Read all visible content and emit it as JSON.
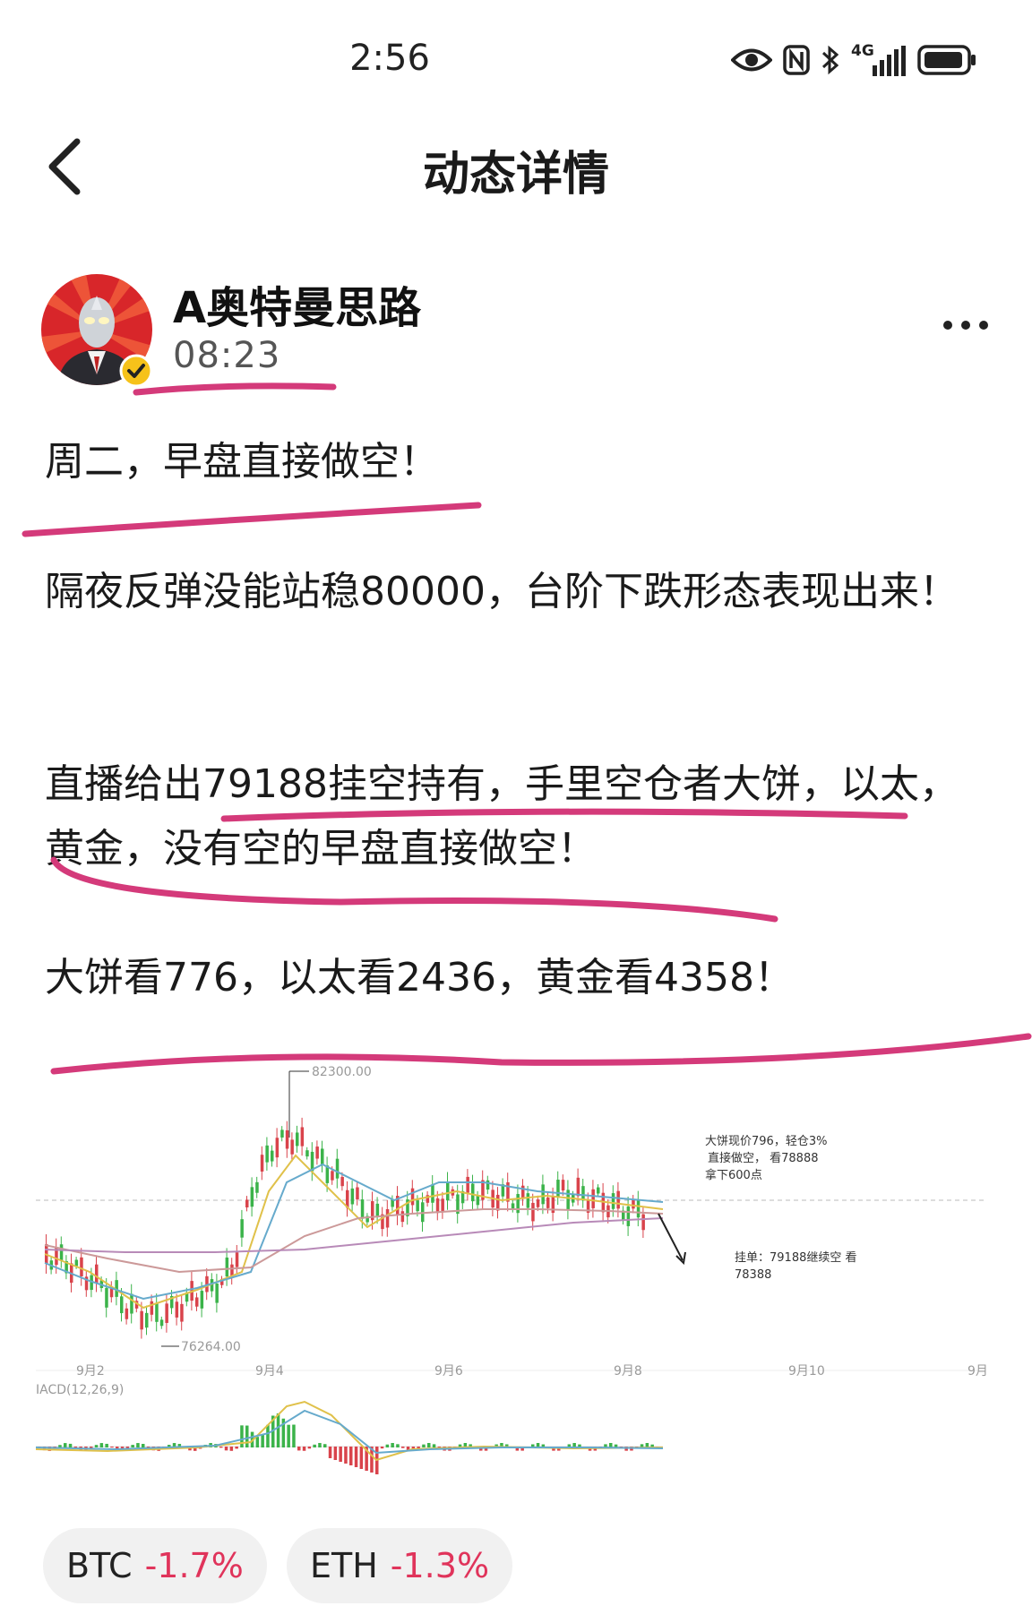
{
  "status_bar": {
    "time": "2:56",
    "network": "4G"
  },
  "header": {
    "title": "动态详情"
  },
  "post": {
    "author": "A奥特曼思路",
    "time": "08:23",
    "paragraphs": [
      "周二，早盘直接做空！",
      "隔夜反弹没能站稳80000，台阶下跌形态表现出来！",
      "直播给出79188挂空持有，手里空仓者大饼，以太，黄金，没有空的早盘直接做空！",
      "大饼看776，以太看2436，黄金看4358！"
    ]
  },
  "chart": {
    "high_label": "82300.00",
    "low_label": "76264.00",
    "note1": [
      "大饼现价796，轻仓3%",
      "直接做空， 看78888",
      "拿下600点"
    ],
    "note2": [
      "挂单：79188继续空 看",
      "78388"
    ],
    "x_labels": [
      "9月2",
      "9月4",
      "9月6",
      "9月8",
      "9月10",
      "9月"
    ],
    "indicator_label": "IACD(12,26,9)"
  },
  "tickers": [
    {
      "symbol": "BTC",
      "change": "-1.7%"
    },
    {
      "symbol": "ETH",
      "change": "-1.3%"
    }
  ],
  "colors": {
    "accent": "#e0345b",
    "marker": "#d43a7a"
  }
}
